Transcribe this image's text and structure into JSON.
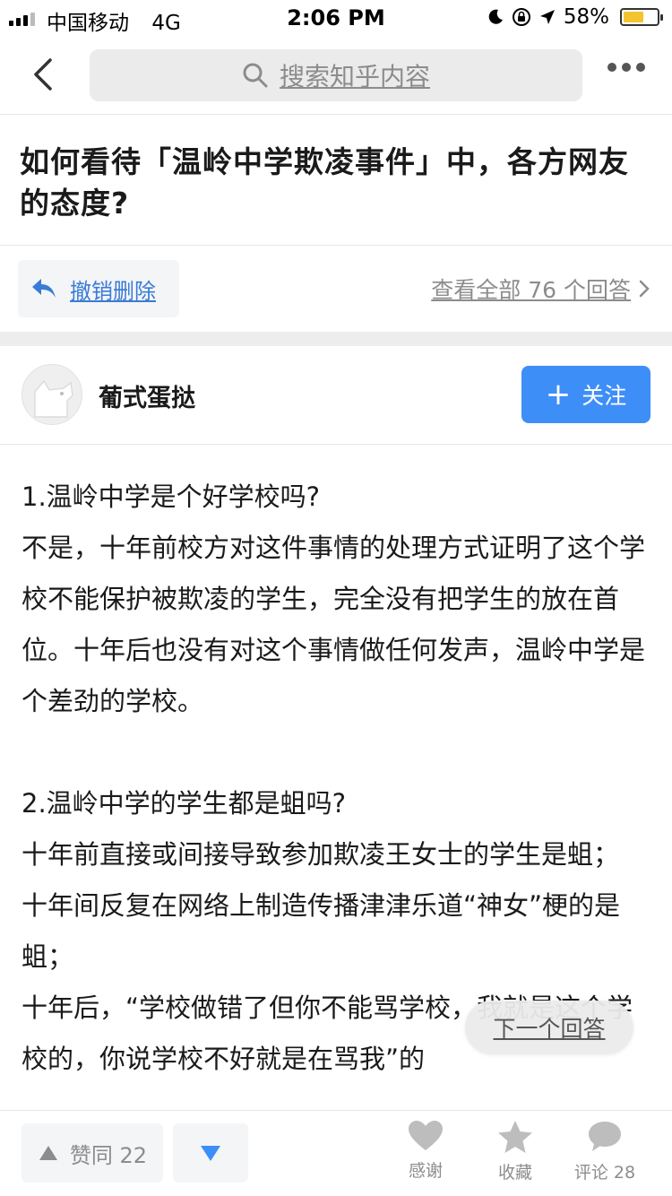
{
  "status_bar": {
    "carrier": "中国移动",
    "network": "4G",
    "time": "2:06 PM",
    "battery": "58%",
    "battery_level": 0.58,
    "icons": [
      "signal-icon",
      "moon-icon",
      "rotation-lock-icon",
      "location-arrow-icon",
      "battery-icon"
    ]
  },
  "nav": {
    "search_placeholder": "搜索知乎内容",
    "icons": [
      "back-arrow-icon",
      "search-icon",
      "more-icon"
    ]
  },
  "question": {
    "title": "如何看待「温岭中学欺凌事件」中，各方网友的态度?"
  },
  "actions": {
    "undo_delete": "撤销删除",
    "view_all": "查看全部 76 个回答"
  },
  "author": {
    "name": "葡式蛋挞",
    "follow_label": "关注"
  },
  "article": {
    "paragraphs": [
      "1.温岭中学是个好学校吗?",
      "不是，十年前校方对这件事情的处理方式证明了这个学校不能保护被欺凌的学生，完全没有把学生的放在首位。十年后也没有对这个事情做任何发声，温岭中学是个差劲的学校。",
      "",
      "2.温岭中学的学生都是蛆吗?",
      "十年前直接或间接导致参加欺凌王女士的学生是蛆；",
      "十年间反复在网络上制造传播津津乐道“神女”梗的是蛆；",
      "十年后，“学校做错了但你不能骂学校，我就是这个学校的，你说学校不好就是在骂我”的"
    ]
  },
  "floating": {
    "next_answer": "下一个回答"
  },
  "bottom_bar": {
    "upvote_label": "赞同 22",
    "thanks_label": "感谢",
    "collect_label": "收藏",
    "comment_label": "评论 28",
    "accent_color": "#3e8ef7"
  }
}
